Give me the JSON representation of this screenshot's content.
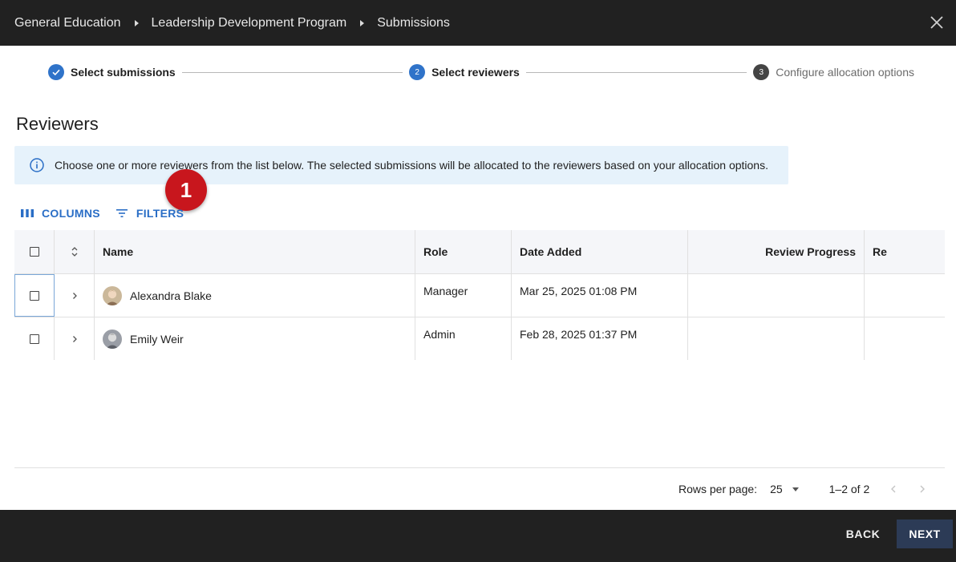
{
  "breadcrumb": {
    "items": [
      "General Education",
      "Leadership Development Program",
      "Submissions"
    ]
  },
  "stepper": {
    "steps": [
      {
        "number": "1",
        "label": "Select submissions",
        "state": "done"
      },
      {
        "number": "2",
        "label": "Select reviewers",
        "state": "active"
      },
      {
        "number": "3",
        "label": "Configure allocation options",
        "state": "todo"
      }
    ]
  },
  "section": {
    "title": "Reviewers"
  },
  "info": {
    "text": "Choose one or more reviewers from the list below. The selected submissions will be allocated to the reviewers based on your allocation options."
  },
  "badge": {
    "number": "1"
  },
  "toolbar": {
    "columns_label": "COLUMNS",
    "filters_label": "FILTERS"
  },
  "table": {
    "headers": {
      "name": "Name",
      "role": "Role",
      "date": "Date Added",
      "progress": "Review Progress",
      "extra": "Re"
    },
    "rows": [
      {
        "name": "Alexandra Blake",
        "role": "Manager",
        "date": "Mar 25, 2025 01:08 PM",
        "progress": "",
        "extra": ""
      },
      {
        "name": "Emily Weir",
        "role": "Admin",
        "date": "Feb 28, 2025 01:37 PM",
        "progress": "",
        "extra": ""
      }
    ]
  },
  "pagination": {
    "rows_label": "Rows per page:",
    "rows_value": "25",
    "range": "1–2 of 2"
  },
  "footer": {
    "back_label": "BACK",
    "next_label": "NEXT"
  },
  "colors": {
    "accent": "#2f73c9",
    "badge": "#c8161d",
    "bar": "#212121",
    "next_button": "#2c3b56",
    "info_bg": "#e6f2fb"
  }
}
